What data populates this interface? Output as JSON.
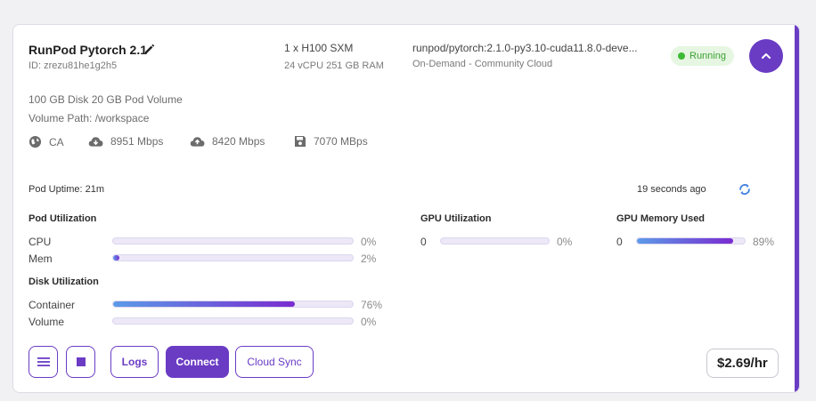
{
  "pod": {
    "name": "RunPod Pytorch 2.1",
    "id": "ID: zrezu81he1g2h5",
    "gpu": "1 x H100 SXM",
    "gpu_spec": "24 vCPU 251 GB RAM",
    "image": "runpod/pytorch:2.1.0-py3.10-cuda11.8.0-deve...",
    "cloud": "On-Demand - Community Cloud",
    "status": "Running",
    "disk": "100 GB Disk  20 GB Pod Volume",
    "volume_path": "Volume Path: /workspace"
  },
  "stats": {
    "region": "CA",
    "download": "8951 Mbps",
    "upload": "8420 Mbps",
    "disk_speed": "7070 MBps"
  },
  "uptime": "Pod Uptime: 21m",
  "updated_ago": "19 seconds ago",
  "pod_utilization": {
    "title": "Pod Utilization",
    "rows": [
      {
        "label": "CPU",
        "value": 0,
        "pct": "0%"
      },
      {
        "label": "Mem",
        "value": 2,
        "pct": "2%"
      }
    ]
  },
  "disk_utilization": {
    "title": "Disk Utilization",
    "rows": [
      {
        "label": "Container",
        "value": 76,
        "pct": "76%"
      },
      {
        "label": "Volume",
        "value": 0,
        "pct": "0%"
      }
    ]
  },
  "gpu_utilization": {
    "title": "GPU Utilization",
    "index": "0",
    "value": 0,
    "pct": "0%"
  },
  "gpu_memory": {
    "title": "GPU Memory Used",
    "index": "0",
    "value": 89,
    "pct": "89%"
  },
  "buttons": {
    "logs": "Logs",
    "connect": "Connect",
    "cloud_sync": "Cloud Sync"
  },
  "price": "$2.69/hr",
  "colors": {
    "accent": "#6a3cc4",
    "running_bg": "#e6f6e2",
    "running_text": "#3ca135",
    "bar_start": "#5b9be8",
    "bar_end": "#7a2bd0"
  },
  "icons": {
    "edit": "pencil-icon",
    "collapse": "chevron-up-icon",
    "region": "globe-icon",
    "download": "cloud-download-icon",
    "upload": "cloud-upload-icon",
    "disk": "floppy-disk-icon",
    "refresh": "refresh-icon",
    "menu": "hamburger-menu-icon",
    "stop": "stop-square-icon"
  }
}
